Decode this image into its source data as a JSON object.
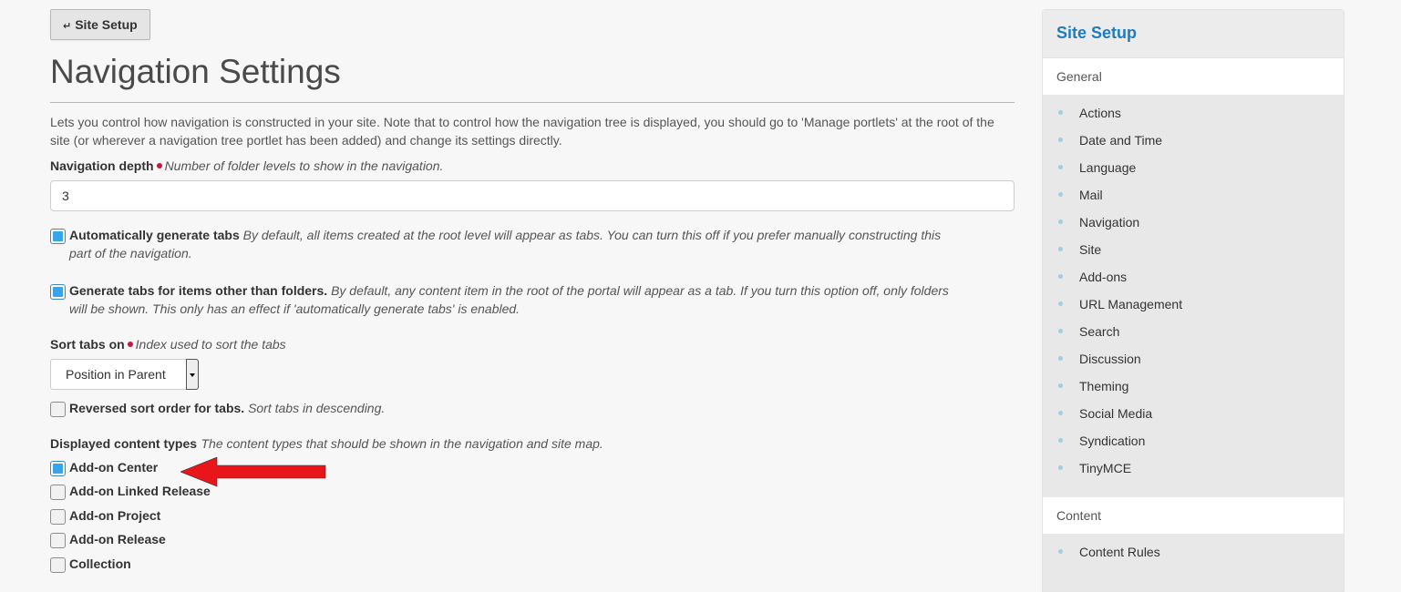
{
  "back_button": {
    "label": "Site Setup"
  },
  "page_title": "Navigation Settings",
  "description": "Lets you control how navigation is constructed in your site. Note that to control how the navigation tree is displayed, you should go to 'Manage portlets' at the root of the site (or wherever a navigation tree portlet has been added) and change its settings directly.",
  "fields": {
    "depth": {
      "label": "Navigation depth",
      "help": "Number of folder levels to show in the navigation.",
      "value": "3"
    },
    "auto_tabs": {
      "label": "Automatically generate tabs",
      "help": "By default, all items created at the root level will appear as tabs. You can turn this off if you prefer manually constructing this part of the navigation.",
      "checked": true
    },
    "nonfolder_tabs": {
      "label": "Generate tabs for items other than folders.",
      "help": "By default, any content item in the root of the portal will appear as a tab. If you turn this option off, only folders will be shown. This only has an effect if 'automatically generate tabs' is enabled.",
      "checked": true
    },
    "sort_tabs": {
      "label": "Sort tabs on",
      "help": "Index used to sort the tabs",
      "value": "Position in Parent"
    },
    "reverse_sort": {
      "label": "Reversed sort order for tabs.",
      "help": "Sort tabs in descending.",
      "checked": false
    },
    "content_types": {
      "label": "Displayed content types",
      "help": "The content types that should be shown in the navigation and site map.",
      "options": [
        {
          "label": "Add-on Center",
          "checked": true
        },
        {
          "label": "Add-on Linked Release",
          "checked": false
        },
        {
          "label": "Add-on Project",
          "checked": false
        },
        {
          "label": "Add-on Release",
          "checked": false
        },
        {
          "label": "Collection",
          "checked": false
        }
      ]
    }
  },
  "annotation": {
    "arrow_color": "#e8161b"
  },
  "sidebar": {
    "title": "Site Setup",
    "sections": [
      {
        "heading": "General",
        "items": [
          "Actions",
          "Date and Time",
          "Language",
          "Mail",
          "Navigation",
          "Site",
          "Add-ons",
          "URL Management",
          "Search",
          "Discussion",
          "Theming",
          "Social Media",
          "Syndication",
          "TinyMCE"
        ]
      },
      {
        "heading": "Content",
        "items": [
          "Content Rules"
        ]
      }
    ]
  },
  "colors": {
    "accent": "#1f7bbd",
    "required": "#c4183c",
    "checkbox": "#35a5ec"
  }
}
